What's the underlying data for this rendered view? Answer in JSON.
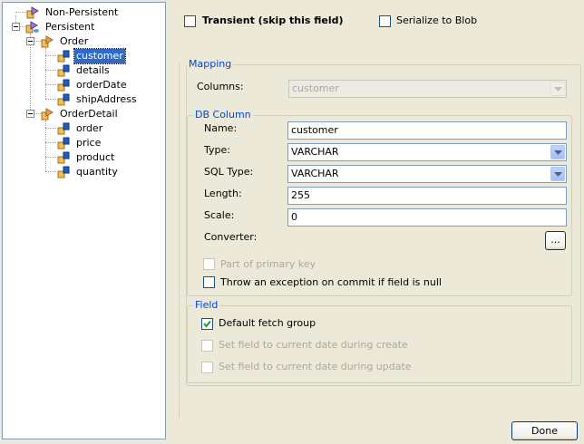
{
  "tree": {
    "nodes": [
      {
        "label": "Non-Persistent",
        "icon": "class-icon"
      },
      {
        "label": "Persistent",
        "icon": "persistent-class-icon"
      },
      {
        "label": "Order",
        "icon": "class-icon"
      },
      {
        "label": "customer",
        "icon": "field-icon",
        "selected": true
      },
      {
        "label": "details",
        "icon": "field-icon"
      },
      {
        "label": "orderDate",
        "icon": "field-icon"
      },
      {
        "label": "shipAddress",
        "icon": "field-icon"
      },
      {
        "label": "OrderDetail",
        "icon": "class-icon"
      },
      {
        "label": "order",
        "icon": "field-icon"
      },
      {
        "label": "price",
        "icon": "field-icon"
      },
      {
        "label": "product",
        "icon": "field-icon"
      },
      {
        "label": "quantity",
        "icon": "field-icon"
      }
    ]
  },
  "top": {
    "transient_label": "Transient (skip this field)",
    "transient_checked": false,
    "serialize_label": "Serialize to Blob",
    "serialize_checked": false
  },
  "mapping": {
    "title": "Mapping",
    "columns_label": "Columns:",
    "columns_value": "customer"
  },
  "db_column": {
    "title": "DB Column",
    "name_label": "Name:",
    "name_value": "customer",
    "type_label": "Type:",
    "type_value": "VARCHAR",
    "sqltype_label": "SQL Type:",
    "sqltype_value": "VARCHAR",
    "length_label": "Length:",
    "length_value": "255",
    "scale_label": "Scale:",
    "scale_value": "0",
    "converter_label": "Converter:",
    "converter_button": "...",
    "primary_key_label": "Part of primary key",
    "primary_key_checked": false,
    "throw_label": "Throw an exception on commit if field is null",
    "throw_checked": false
  },
  "field": {
    "title": "Field",
    "default_fetch_label": "Default fetch group",
    "default_fetch_checked": true,
    "create_label": "Set field to current date during create",
    "update_label": "Set field to current date during update"
  },
  "done_label": "Done",
  "colors": {
    "selection": "#316ac5",
    "group_title": "#0046d5",
    "background": "#ece9d8"
  }
}
